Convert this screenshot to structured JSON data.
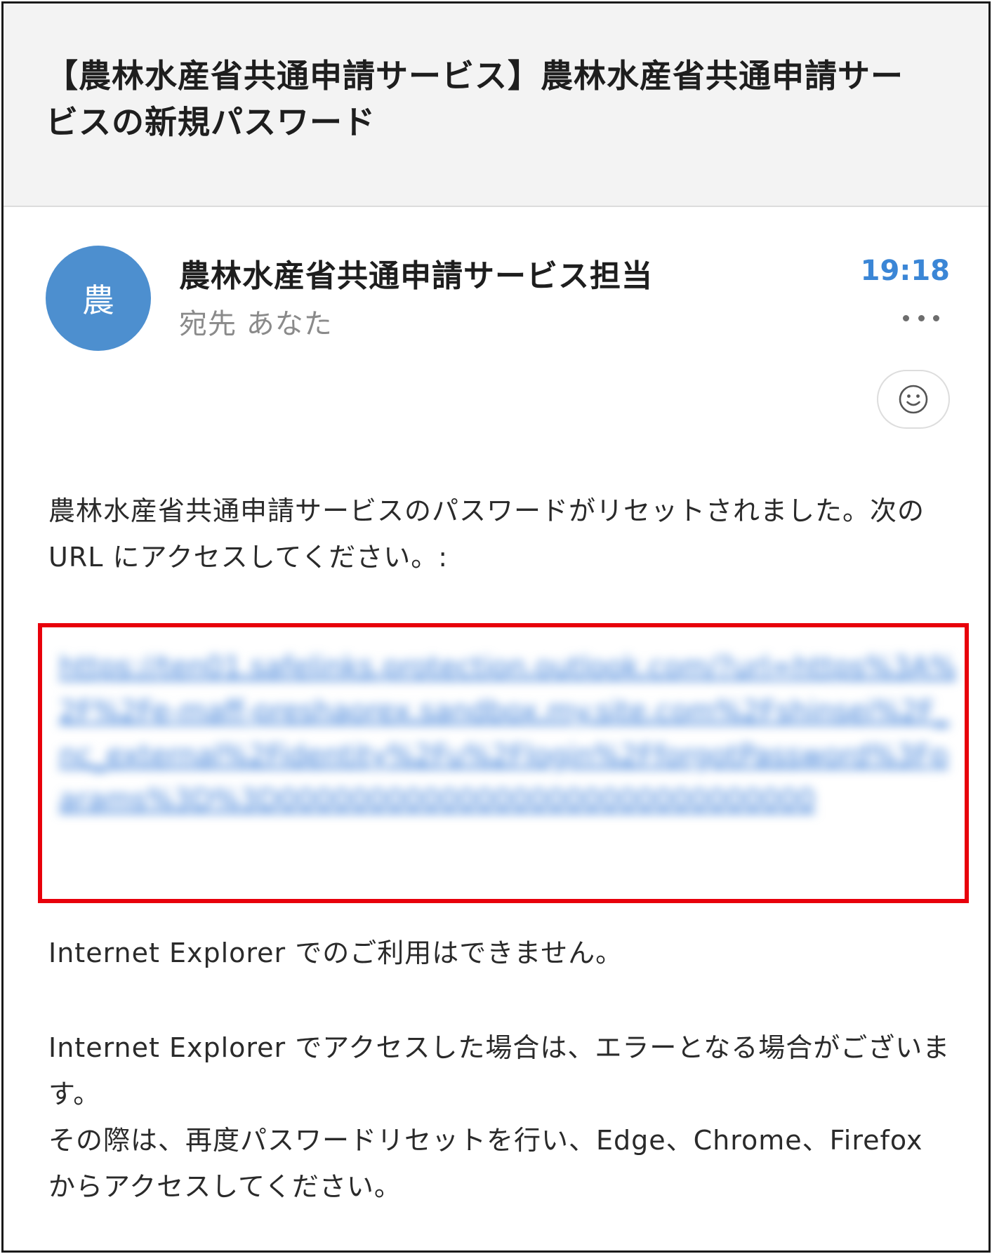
{
  "email": {
    "subject": "【農林水産省共通申請サービス】農林水産省共通申請サービスの新規パスワード",
    "avatar_initial": "農",
    "sender_name": "農林水産省共通申請サービス担当",
    "recipient": "宛先 あなた",
    "time": "19:18",
    "body": {
      "paragraph1": "農林水産省共通申請サービスのパスワードがリセットされました。次の URL にアクセスしてください。:",
      "paragraph2": "Internet Explorer でのご利用はできません。",
      "paragraph3_line1": "Internet Explorer でアクセスした場合は、エラーとなる場合がございます。",
      "paragraph3_line2": "その際は、再度パスワードリセットを行い、Edge、Chrome、Firefox からアクセスしてください。"
    }
  },
  "icons": {
    "avatar": "sender-avatar",
    "more": "more-options-icon",
    "reaction": "smiley-icon"
  },
  "colors": {
    "accent_time": "#3b86d6",
    "avatar_bg": "#4d8fcf",
    "highlight_border": "#e8000b",
    "link": "#3d7fd8"
  }
}
